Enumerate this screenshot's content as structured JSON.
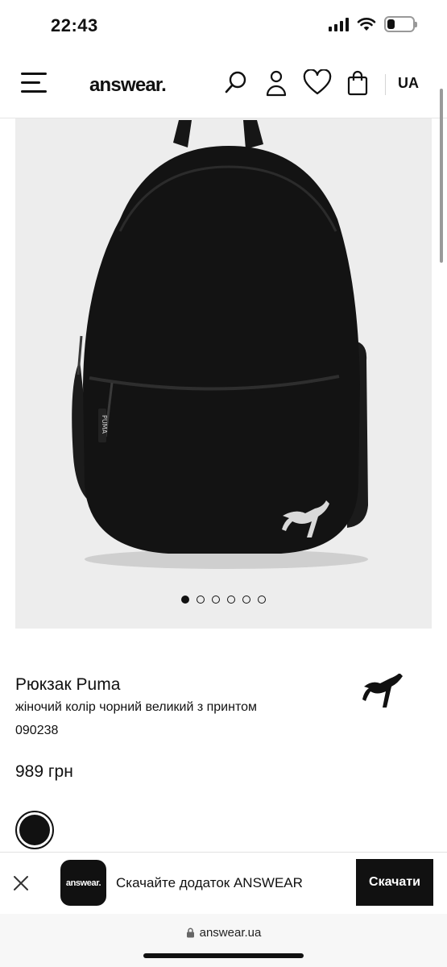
{
  "status_bar": {
    "time": "22:43",
    "battery_level": 0.3
  },
  "header": {
    "logo": "answear.",
    "lang": "UA",
    "icons": [
      "menu-icon",
      "search-icon",
      "user-icon",
      "heart-icon",
      "bag-icon"
    ]
  },
  "gallery": {
    "image_count": 6,
    "active_index": 0
  },
  "product": {
    "name": "Рюкзак Puma",
    "description": "жіночий колір чорний великий з принтом",
    "code": "090238",
    "price": "989 грн",
    "selected_color": "#111111",
    "brand_icon": "puma-logo-icon"
  },
  "app_banner": {
    "app_icon_label": "answear.",
    "text": "Скачайте додаток ANSWEAR",
    "button": "Скачати"
  },
  "browser": {
    "url": "answear.ua"
  }
}
